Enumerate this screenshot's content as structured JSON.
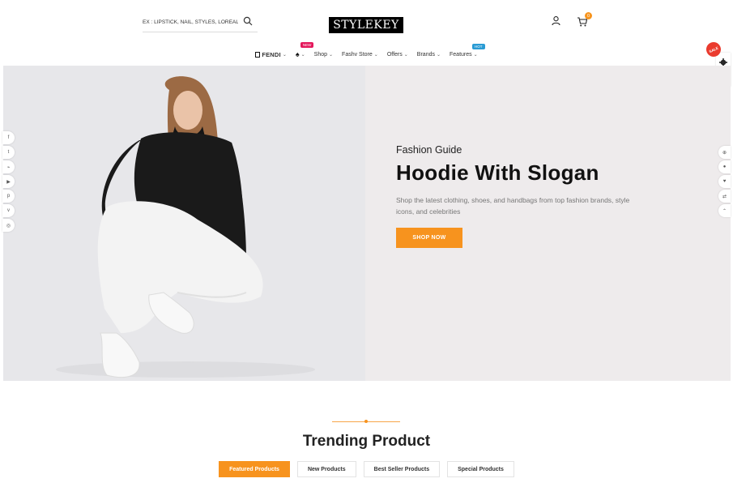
{
  "header": {
    "search_placeholder": "EX : LIPSTICK, NAIL, STYLES, LOREAL, F",
    "logo_text": "STYLEKEY",
    "cart_count": "0"
  },
  "nav": {
    "items": [
      {
        "label": "FENDI",
        "icon": "fendi-logo-icon"
      },
      {
        "label": "",
        "icon": "spade-icon",
        "badge": "NEW"
      },
      {
        "label": "Shop"
      },
      {
        "label": "Fashv Store"
      },
      {
        "label": "Offers"
      },
      {
        "label": "Brands"
      },
      {
        "label": "Features",
        "badge": "HOT"
      }
    ]
  },
  "hero": {
    "subtitle": "Fashion Guide",
    "title": "Hoodie With Slogan",
    "description": "Shop the latest clothing, shoes, and handbags from top fashion brands, style icons, and celebrities",
    "button_label": "SHOP NOW"
  },
  "social_icons": [
    "facebook-icon",
    "twitter-icon",
    "rss-icon",
    "youtube-icon",
    "pinterest-icon",
    "vimeo-icon",
    "instagram-icon"
  ],
  "quick_icons": [
    "cart-icon",
    "user-icon",
    "heart-icon",
    "compare-icon",
    "arrow-up-icon"
  ],
  "sale_badge": "SALE",
  "trending": {
    "title": "Trending Product",
    "tabs": [
      "Featured Products",
      "New Products",
      "Best Seller Products",
      "Special Products"
    ]
  },
  "colors": {
    "accent": "#f7931e",
    "new_badge": "#e4175b",
    "hot_badge": "#2a9bd4",
    "hero_bg": "#eeebec"
  }
}
